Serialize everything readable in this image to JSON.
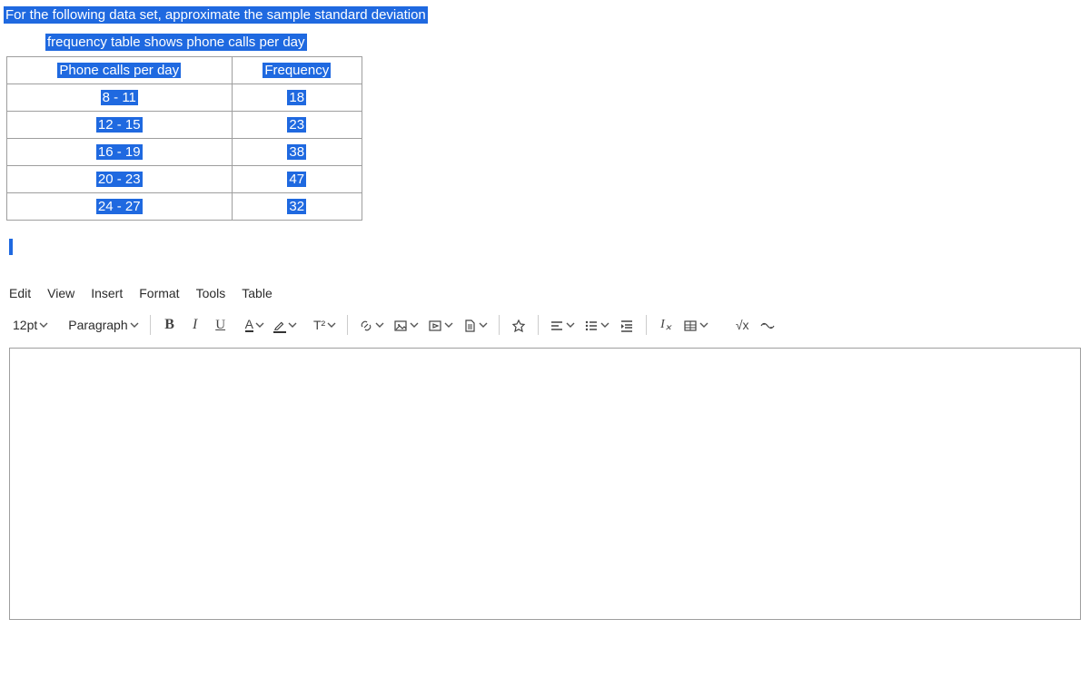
{
  "question": {
    "title": "For the following data set, approximate the sample standard deviation",
    "subtitle": "frequency table shows phone calls per day",
    "table": {
      "header_left": "Phone calls per day",
      "header_right": "Frequency",
      "rows": [
        {
          "range": "8 - 11",
          "freq": "18"
        },
        {
          "range": "12 - 15",
          "freq": "23"
        },
        {
          "range": "16 - 19",
          "freq": "38"
        },
        {
          "range": "20 - 23",
          "freq": "47"
        },
        {
          "range": "24 - 27",
          "freq": "32"
        }
      ]
    }
  },
  "menu": {
    "edit": "Edit",
    "view": "View",
    "insert": "Insert",
    "format": "Format",
    "tools": "Tools",
    "table": "Table"
  },
  "toolbar": {
    "font_size": "12pt",
    "paragraph": "Paragraph",
    "bold": "B",
    "italic": "I",
    "underline": "U",
    "text_color": "A",
    "superscript": "T²",
    "math": "√x"
  }
}
